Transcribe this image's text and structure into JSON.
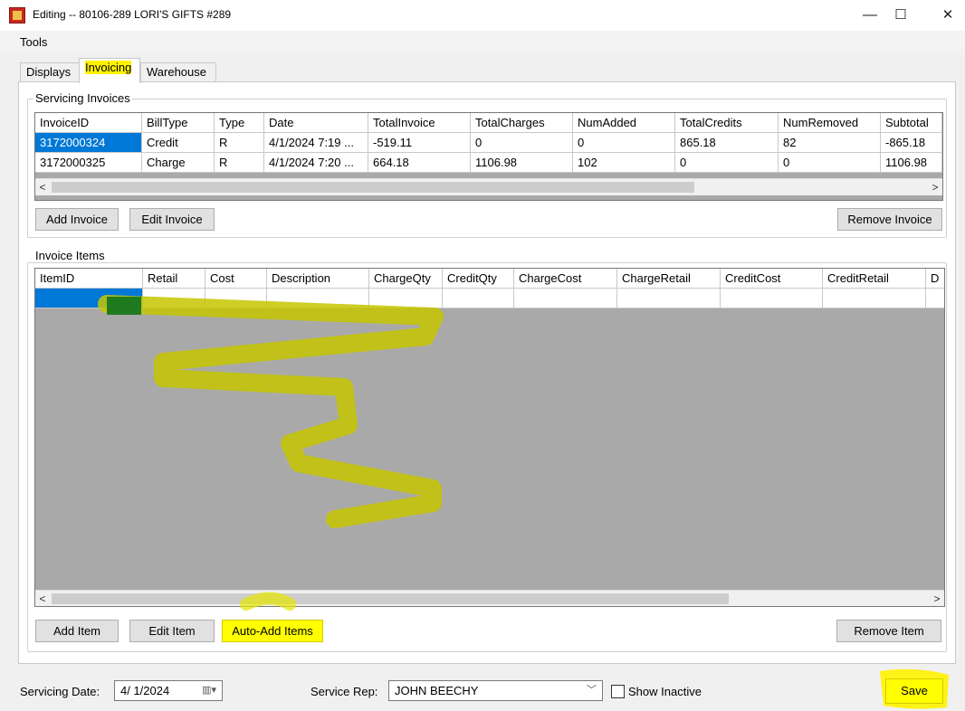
{
  "window": {
    "title": "Editing -- 80106-289 LORI'S GIFTS #289",
    "min": "—",
    "max": "☐",
    "close": "✕"
  },
  "menu": {
    "tools": "Tools"
  },
  "tabs": [
    {
      "label": "Displays"
    },
    {
      "label": "Invoicing"
    },
    {
      "label": "Warehouse"
    }
  ],
  "servicing_invoices": {
    "label": "Servicing Invoices",
    "columns": [
      "InvoiceID",
      "BillType",
      "Type",
      "Date",
      "TotalInvoice",
      "TotalCharges",
      "NumAdded",
      "TotalCredits",
      "NumRemoved",
      "Subtotal"
    ],
    "rows": [
      [
        "3172000324",
        "Credit",
        "R",
        "4/1/2024 7:19 ...",
        "-519.11",
        "0",
        "0",
        "865.18",
        "82",
        "-865.18"
      ],
      [
        "3172000325",
        "Charge",
        "R",
        "4/1/2024 7:20 ...",
        "664.18",
        "1106.98",
        "102",
        "0",
        "0",
        "1106.98"
      ]
    ],
    "add_label": "Add Invoice",
    "edit_label": "Edit Invoice",
    "remove_label": "Remove Invoice"
  },
  "invoice_items": {
    "label": "Invoice Items",
    "columns": [
      "ItemID",
      "Retail",
      "Cost",
      "Description",
      "ChargeQty",
      "CreditQty",
      "ChargeCost",
      "ChargeRetail",
      "CreditCost",
      "CreditRetail",
      "D"
    ],
    "add_label": "Add Item",
    "edit_label": "Edit Item",
    "auto_add_label": "Auto-Add Items",
    "remove_label": "Remove Item"
  },
  "footer": {
    "servicing_date_label": "Servicing Date:",
    "servicing_date_value": "4/ 1/2024",
    "service_rep_label": "Service Rep:",
    "service_rep_value": "JOHN BEECHY",
    "show_inactive_label": "Show Inactive",
    "save_label": "Save"
  },
  "colors": {
    "highlight": "#fff200",
    "selection": "#0078d7",
    "grid_background": "#a9a9a9"
  }
}
